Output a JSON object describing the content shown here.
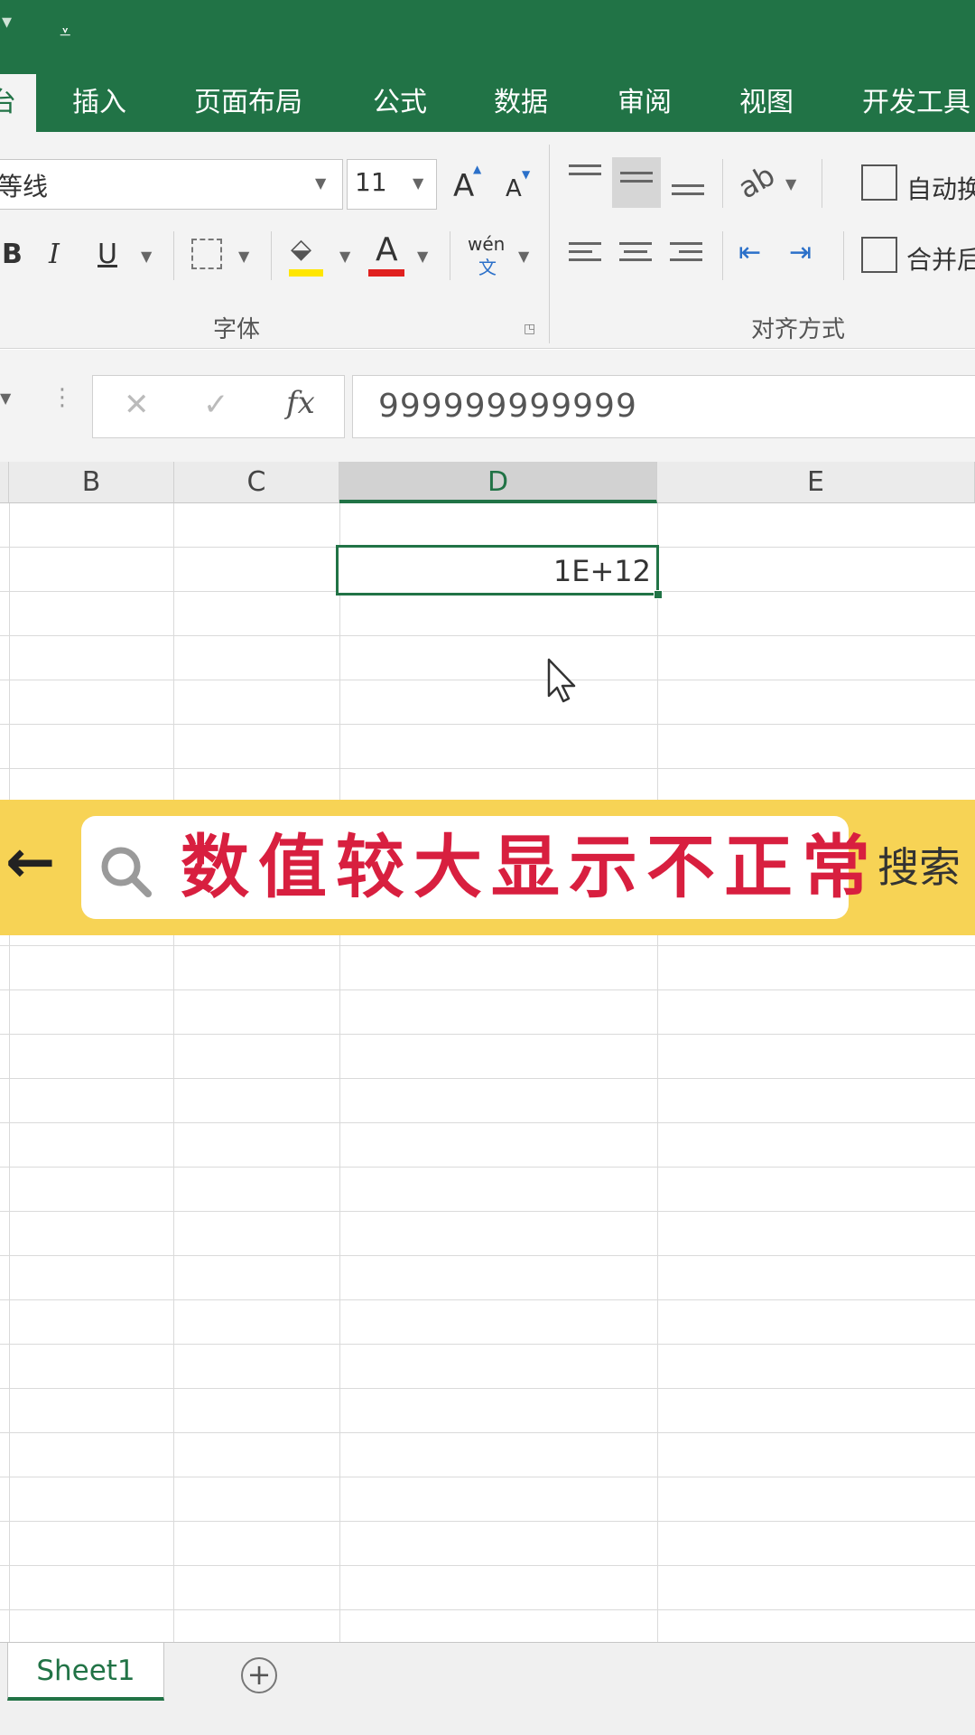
{
  "ribbon": {
    "tabs": [
      {
        "label": "插入"
      },
      {
        "label": "页面布局"
      },
      {
        "label": "公式"
      },
      {
        "label": "数据"
      },
      {
        "label": "审阅"
      },
      {
        "label": "视图"
      },
      {
        "label": "开发工具"
      }
    ],
    "active_tab_fragment": "台",
    "font": {
      "name": "等线",
      "size": "11",
      "grow_label": "A",
      "shrink_label": "A",
      "bold": "B",
      "italic": "I",
      "underline": "U",
      "font_color_label": "A",
      "phonetic_top": "wén",
      "phonetic_bottom": "文",
      "group_label": "字体"
    },
    "alignment": {
      "wrap_text_label": "自动换",
      "merge_label": "合并后",
      "group_label": "对齐方式"
    }
  },
  "formula_bar": {
    "cancel": "✕",
    "enter": "✓",
    "fx": "fx",
    "value": "999999999999"
  },
  "columns": [
    "B",
    "C",
    "D",
    "E"
  ],
  "selected_column": "D",
  "selected_cell": {
    "display": "1E+12"
  },
  "banner": {
    "back": "←",
    "query": "数值较大显示不正常",
    "search_button": "搜索"
  },
  "sheets": [
    {
      "name": "Sheet1"
    }
  ],
  "add_sheet": "+",
  "colors": {
    "excel_green": "#217346",
    "banner_yellow": "#f7d355",
    "query_red": "#d81f3f"
  }
}
